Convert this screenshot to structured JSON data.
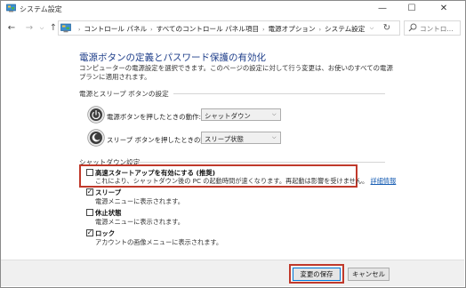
{
  "window": {
    "title": "システム設定",
    "controls": {
      "minimize": "—",
      "maximize": "☐",
      "close": "✕"
    }
  },
  "nav": {
    "back": "←",
    "forward": "→",
    "recent": "⌵",
    "up": "↑",
    "address_path": [
      "コントロール パネル",
      "すべてのコントロール パネル項目",
      "電源オプション",
      "システム設定"
    ],
    "refresh": "↻",
    "search_placeholder": "コントロ..."
  },
  "page": {
    "title": "電源ボタンの定義とパスワード保護の有効化",
    "description": "コンピューターの電源設定を選択できます。このページの設定に対して行う変更は、お使いのすべての電源プランに適用されます。"
  },
  "power_section": {
    "label": "電源とスリープ ボタンの設定",
    "power_button": {
      "label": "電源ボタンを押したときの動作:",
      "value": "シャットダウン"
    },
    "sleep_button": {
      "label": "スリープ ボタンを押したときの動作:",
      "value": "スリープ状態"
    }
  },
  "shutdown_section": {
    "label": "シャットダウン設定",
    "fast_startup": {
      "label": "高速スタートアップを有効にする (推奨)",
      "desc": "これにより、シャットダウン後の PC の起動時間が速くなります。再起動は影響を受けません。",
      "link": "詳細情報",
      "checked": false
    },
    "sleep": {
      "label": "スリープ",
      "desc": "電源メニューに表示されます。",
      "checked": true
    },
    "hibernate": {
      "label": "休止状態",
      "desc": "電源メニューに表示されます。",
      "checked": false
    },
    "lock": {
      "label": "ロック",
      "desc": "アカウントの画像メニューに表示されます。",
      "checked": true
    }
  },
  "footer": {
    "save": "変更の保存",
    "cancel": "キャンセル"
  },
  "colors": {
    "title_blue": "#1e3e8a",
    "highlight_red": "#c0392b",
    "link_blue": "#1a5fb4"
  }
}
